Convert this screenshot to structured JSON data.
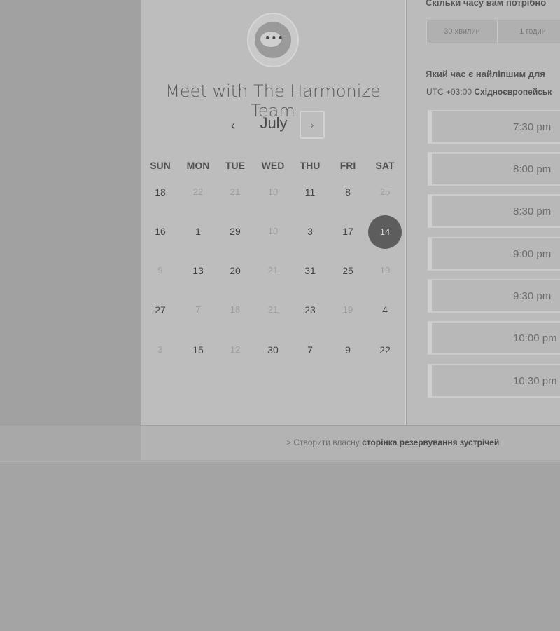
{
  "scheduler": {
    "title": "Meet with The Harmonize Team",
    "month": "July",
    "prev_icon": "‹",
    "next_icon": "›",
    "weekdays": [
      "SUN",
      "MON",
      "TUE",
      "WED",
      "THU",
      "FRI",
      "SAT"
    ],
    "weeks": [
      [
        {
          "d": "18",
          "m": false
        },
        {
          "d": "22",
          "m": true
        },
        {
          "d": "21",
          "m": true
        },
        {
          "d": "10",
          "m": true
        },
        {
          "d": "11",
          "m": false
        },
        {
          "d": "8",
          "m": false
        },
        {
          "d": "25",
          "m": true
        }
      ],
      [
        {
          "d": "16",
          "m": false
        },
        {
          "d": "1",
          "m": false
        },
        {
          "d": "29",
          "m": false
        },
        {
          "d": "10",
          "m": true
        },
        {
          "d": "3",
          "m": false
        },
        {
          "d": "17",
          "m": false
        },
        {
          "d": "14",
          "m": false,
          "selected": true
        }
      ],
      [
        {
          "d": "9",
          "m": true
        },
        {
          "d": "13",
          "m": false
        },
        {
          "d": "20",
          "m": false
        },
        {
          "d": "21",
          "m": true
        },
        {
          "d": "31",
          "m": false
        },
        {
          "d": "25",
          "m": false
        },
        {
          "d": "19",
          "m": true
        }
      ],
      [
        {
          "d": "27",
          "m": false
        },
        {
          "d": "7",
          "m": true
        },
        {
          "d": "18",
          "m": true
        },
        {
          "d": "21",
          "m": true
        },
        {
          "d": "23",
          "m": false
        },
        {
          "d": "19",
          "m": true
        },
        {
          "d": "4",
          "m": false
        }
      ],
      [
        {
          "d": "3",
          "m": true
        },
        {
          "d": "15",
          "m": false
        },
        {
          "d": "12",
          "m": true
        },
        {
          "d": "30",
          "m": false
        },
        {
          "d": "7",
          "m": false
        },
        {
          "d": "9",
          "m": false
        },
        {
          "d": "22",
          "m": false
        }
      ]
    ]
  },
  "booking": {
    "duration_question": "Скільки часу вам потрібно",
    "durations": [
      "30 хвилин",
      "1 годин"
    ],
    "time_question": "Який час є найліпшим для",
    "timezone_prefix": "UTC +03:00",
    "timezone_name": "Східноєвропейськ",
    "slots": [
      "7:30 pm",
      "8:00 pm",
      "8:30 pm",
      "9:00 pm",
      "9:30 pm",
      "10:00 pm",
      "10:30 pm"
    ]
  },
  "footer": {
    "prefix": "> Створити власну",
    "link": "сторінка резервування зустрічей"
  },
  "colors": {
    "selected_day": "#5d5d5d",
    "background": "#a4a4a4"
  }
}
